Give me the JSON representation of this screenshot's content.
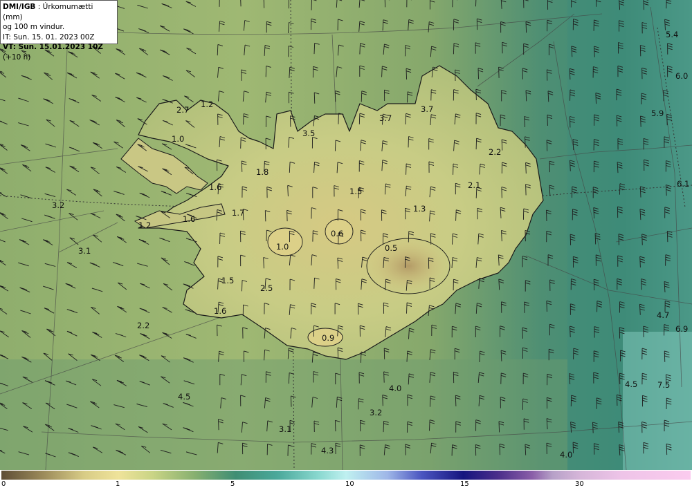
{
  "header": {
    "source": "DMI/IGB",
    "product": ": Úrkomumætti (mm)",
    "subtitle": "og 100 m vindur.",
    "init_time": "IT: Sun. 15. 01. 2023 00Z",
    "valid_time": "VT: Sun. 15.01.2023 10Z",
    "lead": "(+10 h)"
  },
  "values": [
    {
      "text": "5.4"
    },
    {
      "text": "6.0"
    },
    {
      "text": "5.9"
    },
    {
      "text": "6.1"
    },
    {
      "text": "3.7"
    },
    {
      "text": "3.7"
    },
    {
      "text": "3.5"
    },
    {
      "text": "2.2"
    },
    {
      "text": "2.1"
    },
    {
      "text": "1.5"
    },
    {
      "text": "1.3"
    },
    {
      "text": "2.7"
    },
    {
      "text": "1.2"
    },
    {
      "text": "1.0"
    },
    {
      "text": "1.8"
    },
    {
      "text": "1.6"
    },
    {
      "text": "3.2"
    },
    {
      "text": "1.7"
    },
    {
      "text": "1.6"
    },
    {
      "text": "1.2"
    },
    {
      "text": "0.6"
    },
    {
      "text": "1.0"
    },
    {
      "text": "0.5"
    },
    {
      "text": "3.1"
    },
    {
      "text": "1.5"
    },
    {
      "text": "2.5"
    },
    {
      "text": "1.6"
    },
    {
      "text": "2.2"
    },
    {
      "text": "4.7"
    },
    {
      "text": "6.9"
    },
    {
      "text": "0.9"
    },
    {
      "text": "4.0"
    },
    {
      "text": "4.5"
    },
    {
      "text": "7.5"
    },
    {
      "text": "4.5"
    },
    {
      "text": "3.2"
    },
    {
      "text": "3.1"
    },
    {
      "text": "4.3"
    },
    {
      "text": "4.0"
    }
  ],
  "legend": {
    "ticks": [
      "0",
      "1",
      "5",
      "10",
      "15",
      "30"
    ],
    "colors": {
      "low": "#5e4e36",
      "one": "#efe39a",
      "five": "#3f8e74",
      "ten": "#bff0f0",
      "fifteen": "#16157f",
      "thirty": "#fbcbee"
    }
  }
}
